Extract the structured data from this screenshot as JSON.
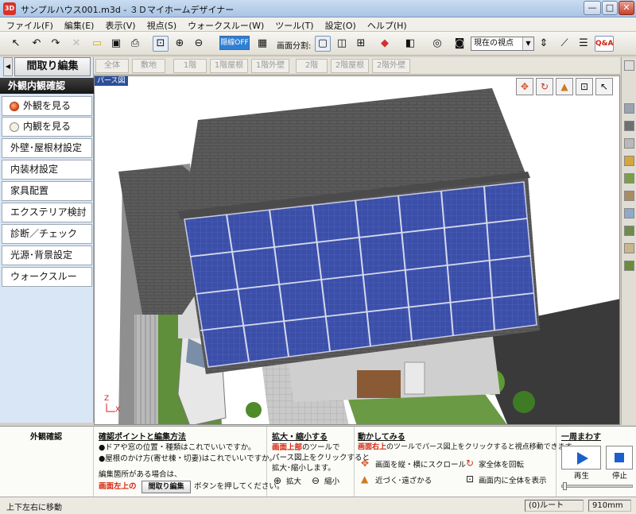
{
  "window": {
    "app_icon": "3D",
    "title": "サンプルハウス001.m3d - ３Ｄマイホームデザイナー",
    "minimize": "—",
    "maximize": "□",
    "close": "✕"
  },
  "menu": [
    "ファイル(F)",
    "編集(E)",
    "表示(V)",
    "視点(S)",
    "ウォークスルー(W)",
    "ツール(T)",
    "設定(O)",
    "ヘルプ(H)"
  ],
  "toolbar": {
    "hidden_line_toggle": "隠線OFF",
    "screen_split_label": "画面分割:",
    "viewpoint_select": "現在の視点",
    "qa_button": "Q&A"
  },
  "mode": {
    "toggle_glyph": "◀",
    "title": "間取り編集"
  },
  "panel": {
    "title": "外観内観確認",
    "items": [
      {
        "label": "外観を見る",
        "selected": true
      },
      {
        "label": "内観を見る",
        "selected": false
      },
      {
        "label": "外壁･屋根材設定"
      },
      {
        "label": "内装材設定"
      },
      {
        "label": "家具配置"
      },
      {
        "label": "エクステリア検討"
      },
      {
        "label": "診断／チェック"
      },
      {
        "label": "光源･背景設定"
      },
      {
        "label": "ウォークスルー"
      }
    ]
  },
  "floor_tabs": [
    "全体",
    "敷地",
    "1階",
    "1階屋根",
    "1階外壁",
    "2階",
    "2階屋根",
    "2階外壁"
  ],
  "viewport": {
    "label": "パース図",
    "axis_z": "Z",
    "axis_x": "X"
  },
  "help": {
    "section_title": "外観確認",
    "edit": {
      "title": "確認ポイントと編集方法",
      "lines": [
        "●ドアや窓の位置・種類はこれでいいですか。",
        "●屋根のかけ方(寄せ棟・切妻)はこれでいいですか。"
      ],
      "note": "編集箇所がある場合は、",
      "red_text": "画面左上の",
      "button": "間取り編集",
      "tail": "ボタンを押してください。"
    },
    "zoom": {
      "title": "拡大・縮小する",
      "red_text": "画面上部",
      "line1_tail": "のツールで",
      "line2": "パース図上をクリックすると",
      "line3": "拡大･縮小します。",
      "zoom_in": "拡大",
      "zoom_out": "縮小"
    },
    "move": {
      "title": "動かしてみる",
      "red_text": "画面右上",
      "line_tail": "のツールでパース図上をクリックすると視点移動できます。",
      "scroll": "画面を縦・横にスクロール",
      "rotate": "家全体を回転",
      "near_far": "近づく･遠ざかる",
      "fit": "画面内に全体を表示"
    },
    "tour": {
      "title": "一周まわす",
      "play": "再生",
      "stop": "停止"
    }
  },
  "status": {
    "text": "上下左右に移動",
    "cell1": "(0)ルート",
    "cell2": "910mm"
  }
}
